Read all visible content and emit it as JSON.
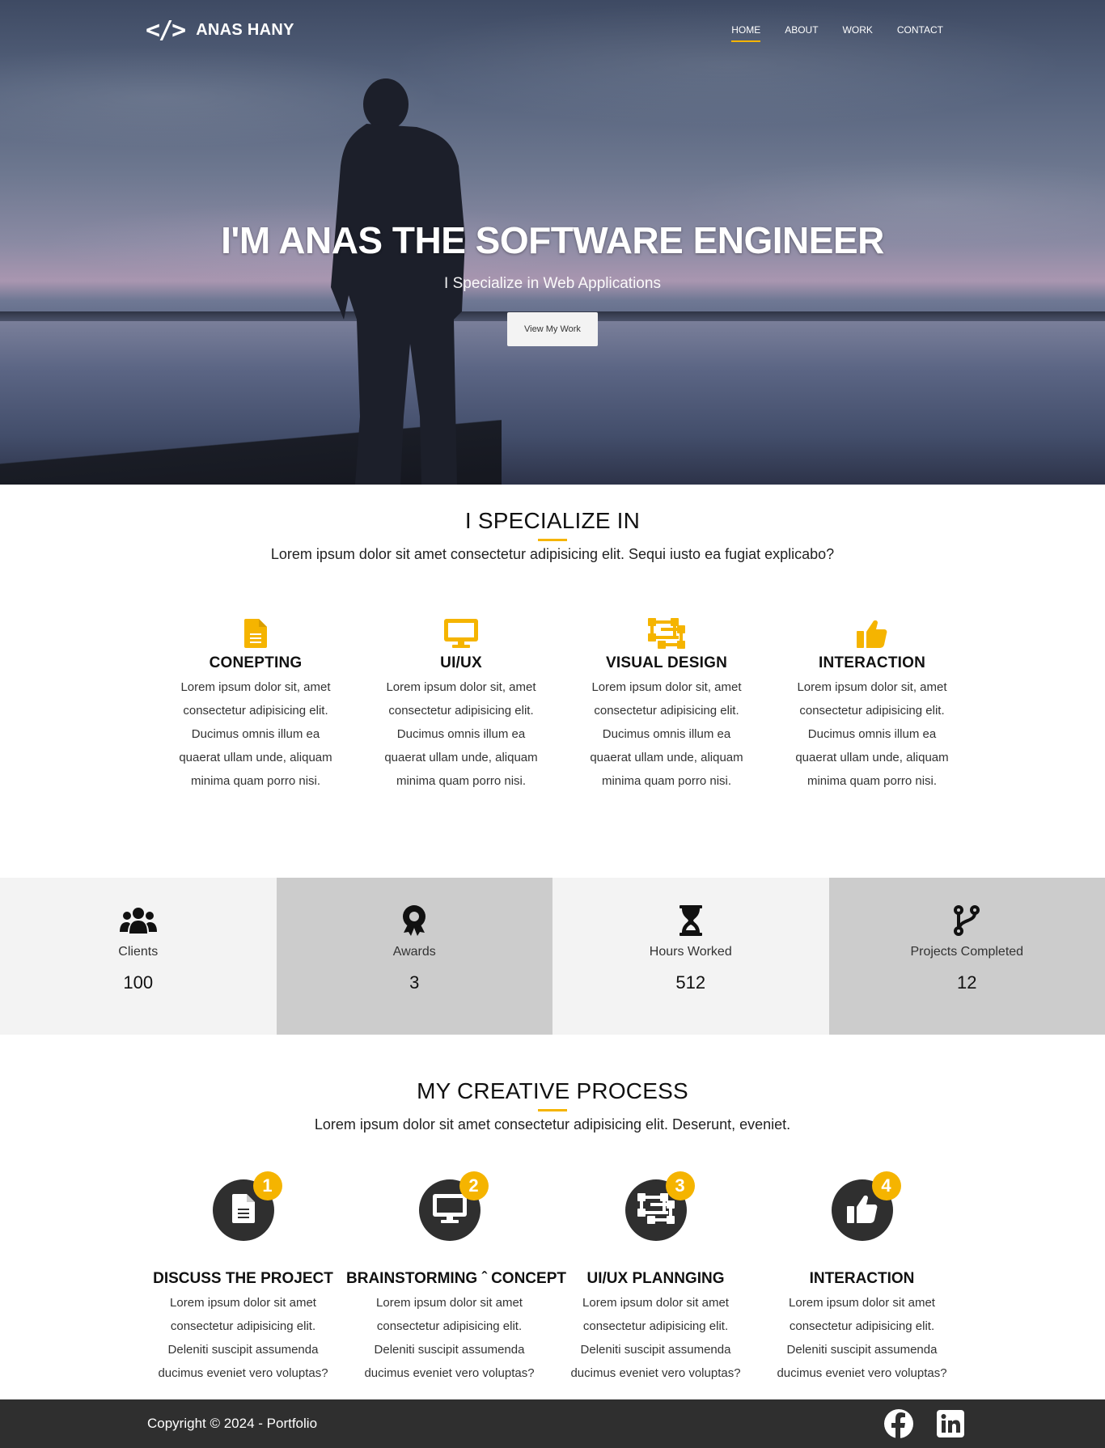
{
  "brand": {
    "logo_glyph": "</>",
    "name": "ANAS HANY"
  },
  "nav": {
    "items": [
      "HOME",
      "ABOUT",
      "WORK",
      "CONTACT"
    ],
    "active": "HOME"
  },
  "hero": {
    "title": "I'M ANAS THE SOFTWARE ENGINEER",
    "subtitle": "I Specialize in Web Applications",
    "button": "View My Work"
  },
  "specialize": {
    "title": "I SPECIALIZE IN",
    "description": "Lorem ipsum dolor sit amet consectetur adipisicing elit. Sequi iusto ea fugiat explicabo?",
    "items": [
      {
        "icon": "file-icon",
        "title": "CONEPTING",
        "text": "Lorem ipsum dolor sit, amet consectetur adipisicing elit. Ducimus omnis illum ea quaerat ullam unde, aliquam minima quam porro nisi."
      },
      {
        "icon": "monitor-icon",
        "title": "UI/UX",
        "text": "Lorem ipsum dolor sit, amet consectetur adipisicing elit. Ducimus omnis illum ea quaerat ullam unde, aliquam minima quam porro nisi."
      },
      {
        "icon": "vector-square-icon",
        "title": "VISUAL DESIGN",
        "text": "Lorem ipsum dolor sit, amet consectetur adipisicing elit. Ducimus omnis illum ea quaerat ullam unde, aliquam minima quam porro nisi."
      },
      {
        "icon": "thumbs-up-icon",
        "title": "INTERACTION",
        "text": "Lorem ipsum dolor sit, amet consectetur adipisicing elit. Ducimus omnis illum ea quaerat ullam unde, aliquam minima quam porro nisi."
      }
    ]
  },
  "stats": [
    {
      "icon": "users-icon",
      "label": "Clients",
      "value": "100"
    },
    {
      "icon": "award-icon",
      "label": "Awards",
      "value": "3"
    },
    {
      "icon": "hourglass-icon",
      "label": "Hours Worked",
      "value": "512"
    },
    {
      "icon": "code-branch-icon",
      "label": "Projects Completed",
      "value": "12"
    }
  ],
  "process": {
    "title": "MY CREATIVE PROCESS",
    "description": "Lorem ipsum dolor sit amet consectetur adipisicing elit. Deserunt, eveniet.",
    "items": [
      {
        "badge": "1",
        "icon": "file-icon",
        "title": "DISCUSS THE PROJECT",
        "text": "Lorem ipsum dolor sit amet consectetur adipisicing elit. Deleniti suscipit assumenda ducimus eveniet vero voluptas?"
      },
      {
        "badge": "2",
        "icon": "monitor-icon",
        "title": "BRAINSTORMING ˆ CONCEPT",
        "text": "Lorem ipsum dolor sit amet consectetur adipisicing elit. Deleniti suscipit assumenda ducimus eveniet vero voluptas?"
      },
      {
        "badge": "3",
        "icon": "vector-square-icon",
        "title": "UI/UX PLANNGING",
        "text": "Lorem ipsum dolor sit amet consectetur adipisicing elit. Deleniti suscipit assumenda ducimus eveniet vero voluptas?"
      },
      {
        "badge": "4",
        "icon": "thumbs-up-icon",
        "title": "INTERACTION",
        "text": "Lorem ipsum dolor sit amet consectetur adipisicing elit. Deleniti suscipit assumenda ducimus eveniet vero voluptas?"
      }
    ]
  },
  "footer": {
    "copyright": "Copyright © 2024 - Portfolio",
    "socials": [
      "facebook-icon",
      "linkedin-icon"
    ]
  },
  "colors": {
    "accent": "#f5b400",
    "dark": "#2f2f2f",
    "stat_light": "#f3f3f3",
    "stat_dark": "#cccccc"
  }
}
